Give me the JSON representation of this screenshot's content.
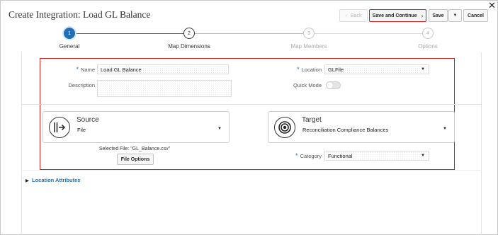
{
  "window": {
    "title": "Create Integration: Load GL Balance",
    "close_glyph": "✕"
  },
  "toolbar": {
    "back_label": "Back",
    "save_continue_label": "Save and Continue",
    "save_label": "Save",
    "cancel_label": "Cancel"
  },
  "train": {
    "steps": [
      {
        "number": "1",
        "label": "General",
        "state": "current"
      },
      {
        "number": "2",
        "label": "Map Dimensions",
        "state": "enabled"
      },
      {
        "number": "3",
        "label": "Map Members",
        "state": "disabled"
      },
      {
        "number": "4",
        "label": "Options",
        "state": "disabled"
      }
    ]
  },
  "form": {
    "name_label": "Name",
    "name_value": "Load GL Balance",
    "description_label": "Description",
    "description_value": "",
    "location_label": "Location",
    "location_value": "GLFile",
    "quick_mode_label": "Quick Mode",
    "quick_mode_on": false
  },
  "source": {
    "title": "Source",
    "value": "File",
    "selected_file_text": "Selected File: \"GL_Balance.csv\"",
    "file_options_label": "File Options"
  },
  "target": {
    "title": "Target",
    "value": "Reconciliation Compliance Balances",
    "category_label": "Category",
    "category_value": "Functional"
  },
  "location_attributes_label": "Location Attributes",
  "colors": {
    "accent": "#1f6fb8",
    "highlight": "#d41f1f"
  }
}
